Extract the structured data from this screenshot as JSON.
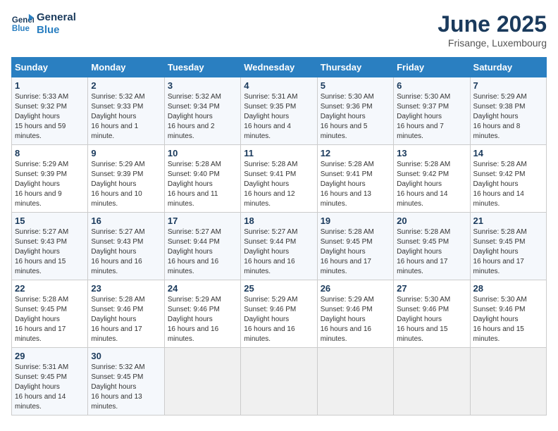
{
  "header": {
    "logo_line1": "General",
    "logo_line2": "Blue",
    "month_title": "June 2025",
    "location": "Frisange, Luxembourg"
  },
  "weekdays": [
    "Sunday",
    "Monday",
    "Tuesday",
    "Wednesday",
    "Thursday",
    "Friday",
    "Saturday"
  ],
  "weeks": [
    [
      {
        "day": "1",
        "sunrise": "Sunrise: 5:33 AM",
        "sunset": "Sunset: 9:32 PM",
        "daylight": "Daylight: 15 hours and 59 minutes."
      },
      {
        "day": "2",
        "sunrise": "Sunrise: 5:32 AM",
        "sunset": "Sunset: 9:33 PM",
        "daylight": "Daylight: 16 hours and 1 minute."
      },
      {
        "day": "3",
        "sunrise": "Sunrise: 5:32 AM",
        "sunset": "Sunset: 9:34 PM",
        "daylight": "Daylight: 16 hours and 2 minutes."
      },
      {
        "day": "4",
        "sunrise": "Sunrise: 5:31 AM",
        "sunset": "Sunset: 9:35 PM",
        "daylight": "Daylight: 16 hours and 4 minutes."
      },
      {
        "day": "5",
        "sunrise": "Sunrise: 5:30 AM",
        "sunset": "Sunset: 9:36 PM",
        "daylight": "Daylight: 16 hours and 5 minutes."
      },
      {
        "day": "6",
        "sunrise": "Sunrise: 5:30 AM",
        "sunset": "Sunset: 9:37 PM",
        "daylight": "Daylight: 16 hours and 7 minutes."
      },
      {
        "day": "7",
        "sunrise": "Sunrise: 5:29 AM",
        "sunset": "Sunset: 9:38 PM",
        "daylight": "Daylight: 16 hours and 8 minutes."
      }
    ],
    [
      {
        "day": "8",
        "sunrise": "Sunrise: 5:29 AM",
        "sunset": "Sunset: 9:39 PM",
        "daylight": "Daylight: 16 hours and 9 minutes."
      },
      {
        "day": "9",
        "sunrise": "Sunrise: 5:29 AM",
        "sunset": "Sunset: 9:39 PM",
        "daylight": "Daylight: 16 hours and 10 minutes."
      },
      {
        "day": "10",
        "sunrise": "Sunrise: 5:28 AM",
        "sunset": "Sunset: 9:40 PM",
        "daylight": "Daylight: 16 hours and 11 minutes."
      },
      {
        "day": "11",
        "sunrise": "Sunrise: 5:28 AM",
        "sunset": "Sunset: 9:41 PM",
        "daylight": "Daylight: 16 hours and 12 minutes."
      },
      {
        "day": "12",
        "sunrise": "Sunrise: 5:28 AM",
        "sunset": "Sunset: 9:41 PM",
        "daylight": "Daylight: 16 hours and 13 minutes."
      },
      {
        "day": "13",
        "sunrise": "Sunrise: 5:28 AM",
        "sunset": "Sunset: 9:42 PM",
        "daylight": "Daylight: 16 hours and 14 minutes."
      },
      {
        "day": "14",
        "sunrise": "Sunrise: 5:28 AM",
        "sunset": "Sunset: 9:42 PM",
        "daylight": "Daylight: 16 hours and 14 minutes."
      }
    ],
    [
      {
        "day": "15",
        "sunrise": "Sunrise: 5:27 AM",
        "sunset": "Sunset: 9:43 PM",
        "daylight": "Daylight: 16 hours and 15 minutes."
      },
      {
        "day": "16",
        "sunrise": "Sunrise: 5:27 AM",
        "sunset": "Sunset: 9:43 PM",
        "daylight": "Daylight: 16 hours and 16 minutes."
      },
      {
        "day": "17",
        "sunrise": "Sunrise: 5:27 AM",
        "sunset": "Sunset: 9:44 PM",
        "daylight": "Daylight: 16 hours and 16 minutes."
      },
      {
        "day": "18",
        "sunrise": "Sunrise: 5:27 AM",
        "sunset": "Sunset: 9:44 PM",
        "daylight": "Daylight: 16 hours and 16 minutes."
      },
      {
        "day": "19",
        "sunrise": "Sunrise: 5:28 AM",
        "sunset": "Sunset: 9:45 PM",
        "daylight": "Daylight: 16 hours and 17 minutes."
      },
      {
        "day": "20",
        "sunrise": "Sunrise: 5:28 AM",
        "sunset": "Sunset: 9:45 PM",
        "daylight": "Daylight: 16 hours and 17 minutes."
      },
      {
        "day": "21",
        "sunrise": "Sunrise: 5:28 AM",
        "sunset": "Sunset: 9:45 PM",
        "daylight": "Daylight: 16 hours and 17 minutes."
      }
    ],
    [
      {
        "day": "22",
        "sunrise": "Sunrise: 5:28 AM",
        "sunset": "Sunset: 9:45 PM",
        "daylight": "Daylight: 16 hours and 17 minutes."
      },
      {
        "day": "23",
        "sunrise": "Sunrise: 5:28 AM",
        "sunset": "Sunset: 9:46 PM",
        "daylight": "Daylight: 16 hours and 17 minutes."
      },
      {
        "day": "24",
        "sunrise": "Sunrise: 5:29 AM",
        "sunset": "Sunset: 9:46 PM",
        "daylight": "Daylight: 16 hours and 16 minutes."
      },
      {
        "day": "25",
        "sunrise": "Sunrise: 5:29 AM",
        "sunset": "Sunset: 9:46 PM",
        "daylight": "Daylight: 16 hours and 16 minutes."
      },
      {
        "day": "26",
        "sunrise": "Sunrise: 5:29 AM",
        "sunset": "Sunset: 9:46 PM",
        "daylight": "Daylight: 16 hours and 16 minutes."
      },
      {
        "day": "27",
        "sunrise": "Sunrise: 5:30 AM",
        "sunset": "Sunset: 9:46 PM",
        "daylight": "Daylight: 16 hours and 15 minutes."
      },
      {
        "day": "28",
        "sunrise": "Sunrise: 5:30 AM",
        "sunset": "Sunset: 9:46 PM",
        "daylight": "Daylight: 16 hours and 15 minutes."
      }
    ],
    [
      {
        "day": "29",
        "sunrise": "Sunrise: 5:31 AM",
        "sunset": "Sunset: 9:45 PM",
        "daylight": "Daylight: 16 hours and 14 minutes."
      },
      {
        "day": "30",
        "sunrise": "Sunrise: 5:32 AM",
        "sunset": "Sunset: 9:45 PM",
        "daylight": "Daylight: 16 hours and 13 minutes."
      },
      null,
      null,
      null,
      null,
      null
    ]
  ]
}
